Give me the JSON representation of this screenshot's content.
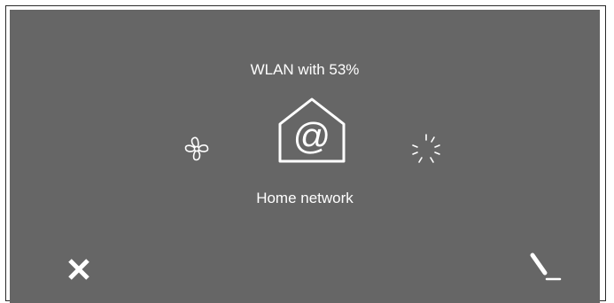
{
  "status": {
    "wlan_text": "WLAN with 53%",
    "signal_percent": 53
  },
  "network": {
    "name": "Home network"
  },
  "icons": {
    "left": "fan-icon",
    "center": "home-network-at-icon",
    "right": "loading-spinner-icon",
    "close": "close-icon",
    "edit": "edit-pen-icon"
  },
  "colors": {
    "screen_background": "#666666",
    "foreground": "#ffffff",
    "frame_border": "#2a2a2a"
  }
}
